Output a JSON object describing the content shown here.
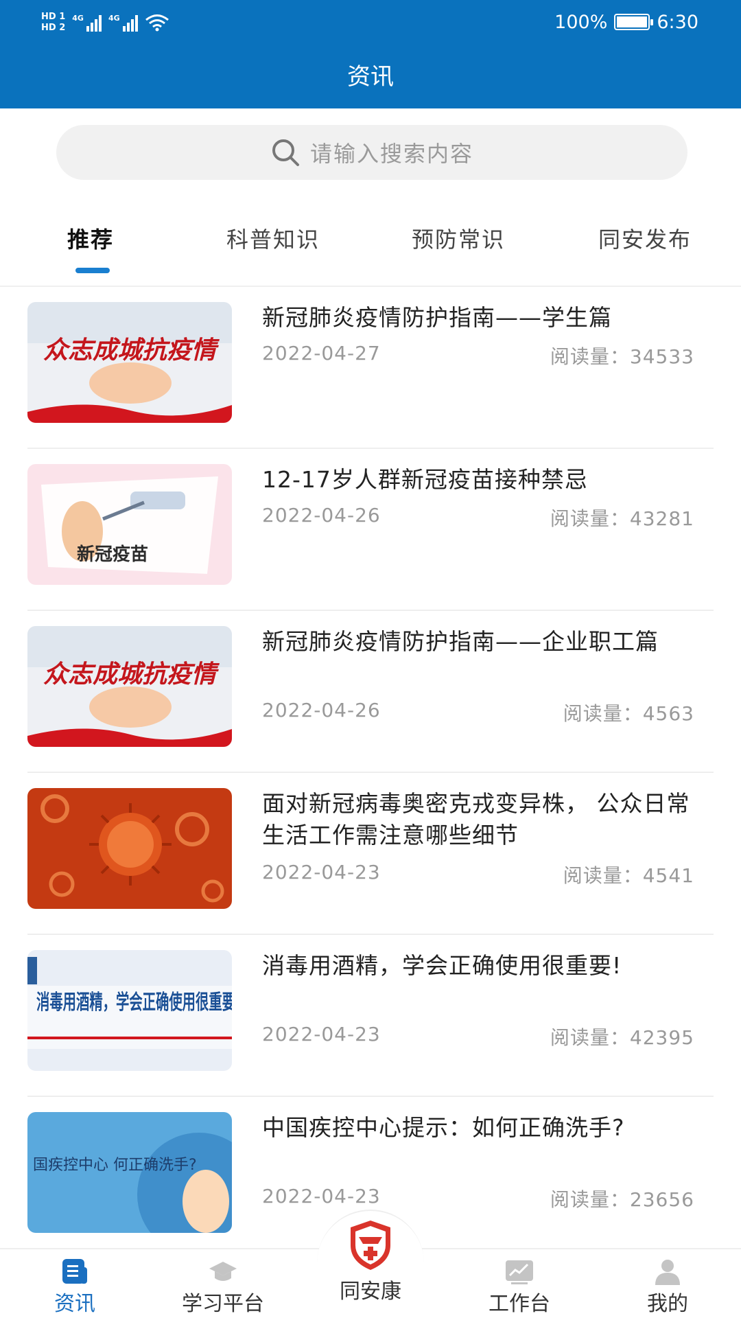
{
  "status_bar": {
    "hd1": "HD 1",
    "hd2": "HD 2",
    "sim1": "4G",
    "sim2": "4G",
    "battery": "100%",
    "time": "6:30"
  },
  "header": {
    "title": "资讯"
  },
  "search": {
    "placeholder": "请输入搜索内容",
    "icon": "search-icon"
  },
  "tabs": [
    {
      "label": "推荐",
      "active": true
    },
    {
      "label": "科普知识",
      "active": false
    },
    {
      "label": "预防常识",
      "active": false
    },
    {
      "label": "同安发布",
      "active": false
    }
  ],
  "articles": [
    {
      "title": "新冠肺炎疫情防护指南——学生篇",
      "date": "2022-04-27",
      "reads": "阅读量：34533",
      "thumb_text": "众志成城抗疫情"
    },
    {
      "title": "12-17岁人群新冠疫苗接种禁忌",
      "date": "2022-04-26",
      "reads": "阅读量：43281",
      "thumb_text": "新冠疫苗"
    },
    {
      "title": "新冠肺炎疫情防护指南——企业职工篇",
      "date": "2022-04-26",
      "reads": "阅读量：4563",
      "thumb_text": "众志成城抗疫情"
    },
    {
      "title": "面对新冠病毒奥密克戎变异株， 公众日常生活工作需注意哪些细节",
      "date": "2022-04-23",
      "reads": "阅读量：4541",
      "thumb_text": ""
    },
    {
      "title": "消毒用酒精，学会正确使用很重要!",
      "date": "2022-04-23",
      "reads": "阅读量：42395",
      "thumb_text": "消毒用酒精，学会正确使用很重要"
    },
    {
      "title": "中国疾控中心提示：如何正确洗手?",
      "date": "2022-04-23",
      "reads": "阅读量：23656",
      "thumb_text": "国疾控中心 何正确洗手?"
    }
  ],
  "bottom_nav": [
    {
      "label": "资讯",
      "icon": "news-icon",
      "active": true
    },
    {
      "label": "学习平台",
      "icon": "graduation-cap-icon",
      "active": false
    },
    {
      "label": "同安康",
      "icon": "shield-cross-icon",
      "active": false
    },
    {
      "label": "工作台",
      "icon": "chart-icon",
      "active": false
    },
    {
      "label": "我的",
      "icon": "user-icon",
      "active": false
    }
  ],
  "colors": {
    "header_bg": "#0a72bd",
    "accent": "#1a7fd0",
    "center_icon": "#d9342b"
  }
}
